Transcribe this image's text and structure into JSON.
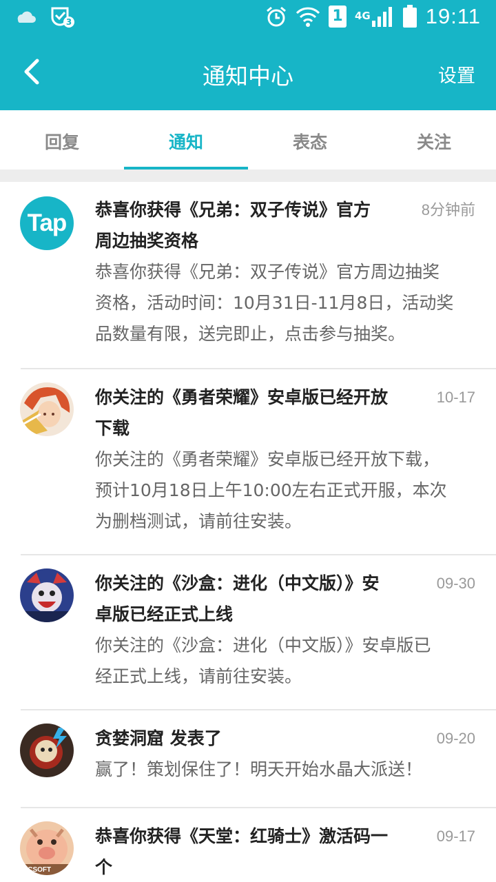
{
  "status_bar": {
    "time": "19:11",
    "network": "4G",
    "sim": "1",
    "notification_count": "3",
    "icons": [
      "weather-icon",
      "notification-shield-icon",
      "alarm-icon",
      "wifi-icon",
      "sim-icon",
      "signal-icon",
      "battery-icon"
    ]
  },
  "header": {
    "title": "通知中心",
    "settings_label": "设置",
    "back_icon": "back-arrow-icon"
  },
  "tabs": [
    {
      "label": "回复",
      "active": false
    },
    {
      "label": "通知",
      "active": true
    },
    {
      "label": "表态",
      "active": false
    },
    {
      "label": "关注",
      "active": false
    }
  ],
  "colors": {
    "accent": "#17b5c7",
    "title_text": "#222222",
    "body_text": "#666666",
    "time_text": "#9a9a9a"
  },
  "notifications": [
    {
      "avatar_text": "Tap",
      "title_lines": [
        "恭喜你获得《兄弟：双子传说》官方",
        "周边抽奖资格"
      ],
      "time": "8分钟前",
      "body_lines": [
        "恭喜你获得《兄弟：双子传说》官方周边抽奖",
        "资格，活动时间：10月31日-11月8日，活动奖",
        "品数量有限，送完即止，点击参与抽奖。"
      ]
    },
    {
      "avatar_text": "",
      "title_lines": [
        "你关注的《勇者荣耀》安卓版已经开放",
        "下载"
      ],
      "time": "10-17",
      "body_lines": [
        "你关注的《勇者荣耀》安卓版已经开放下载，",
        "预计10月18日上午10:00左右正式开服，本次",
        "为删档测试，请前往安装。"
      ]
    },
    {
      "avatar_text": "",
      "title_lines": [
        "你关注的《沙盒：进化（中文版）》安",
        "卓版已经正式上线"
      ],
      "time": "09-30",
      "body_lines": [
        "你关注的《沙盒：进化（中文版）》安卓版已",
        "经正式上线，请前往安装。"
      ]
    },
    {
      "avatar_text": "",
      "title_lines": [
        "贪婪洞窟 发表了"
      ],
      "time": "09-20",
      "body_lines": [
        "赢了！策划保住了！明天开始水晶大派送！"
      ]
    },
    {
      "avatar_text": "RCSOFT",
      "title_lines": [
        "恭喜你获得《天堂：红骑士》激活码一",
        "个"
      ],
      "time": "09-17",
      "body_lines": []
    }
  ]
}
